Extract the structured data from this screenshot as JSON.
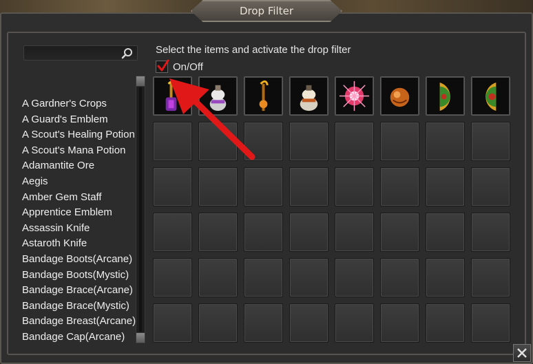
{
  "window": {
    "title": "Drop Filter"
  },
  "search": {
    "value": "",
    "placeholder": ""
  },
  "instruction": "Select the items and activate the drop filter",
  "toggle": {
    "label": "On/Off",
    "checked": true
  },
  "item_list": [
    "A Gardner's Crops",
    "A Guard's Emblem",
    "A Scout's Healing Potion",
    "A Scout's Mana Potion",
    "Adamantite Ore",
    "Aegis",
    "Amber Gem Staff",
    "Apprentice Emblem",
    "Assassin Knife",
    "Astaroth Knife",
    "Bandage Boots(Arcane)",
    "Bandage Boots(Mystic)",
    "Bandage Brace(Arcane)",
    "Bandage Brace(Mystic)",
    "Bandage Breast(Arcane)",
    "Bandage Cap(Arcane)"
  ],
  "selected_items": [
    {
      "icon": "staff-icon"
    },
    {
      "icon": "potion-white-icon"
    },
    {
      "icon": "staff-orange-icon"
    },
    {
      "icon": "potion-bag-icon"
    },
    {
      "icon": "sparkle-orb-icon"
    },
    {
      "icon": "orange-orb-icon"
    },
    {
      "icon": "shield-half-icon"
    },
    {
      "icon": "shield-round-icon"
    }
  ],
  "colors": {
    "accent_red": "#e01818",
    "panel": "#2c2c2c",
    "text": "#efefef"
  }
}
